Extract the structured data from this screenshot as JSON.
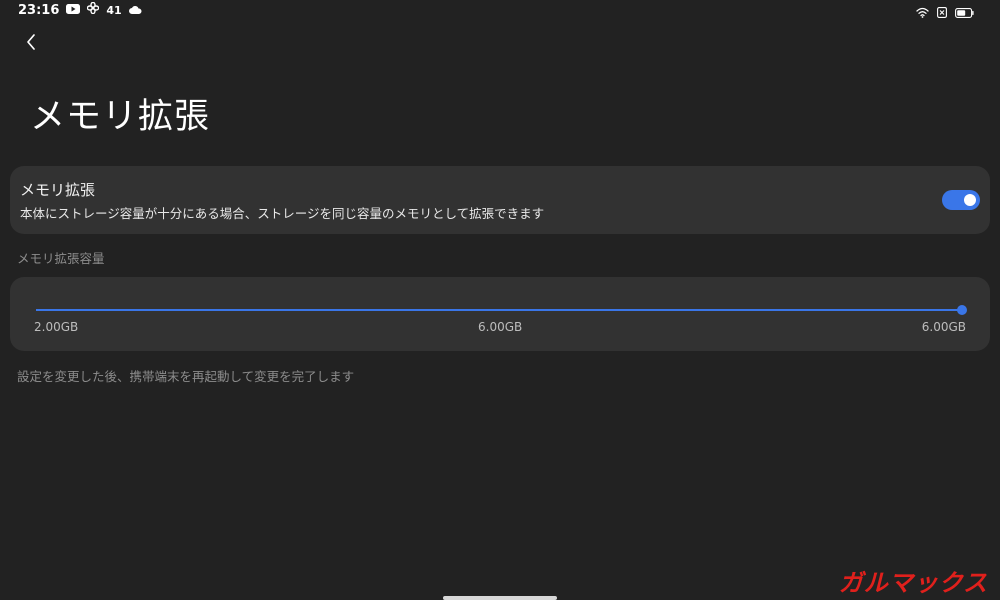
{
  "status_bar": {
    "time": "23:16",
    "notification_count": "41"
  },
  "page": {
    "title": "メモリ拡張"
  },
  "toggle_card": {
    "title": "メモリ拡張",
    "description": "本体にストレージ容量が十分にある場合、ストレージを同じ容量のメモリとして拡張できます",
    "enabled": true
  },
  "slider_section": {
    "label": "メモリ拡張容量",
    "min_label": "2.00GB",
    "mid_label": "6.00GB",
    "max_label": "6.00GB",
    "value_fraction": 1.0
  },
  "note": "設定を変更した後、携帯端末を再起動して変更を完了します",
  "watermark": "ガルマックス",
  "colors": {
    "background": "#222222",
    "card": "#323232",
    "accent": "#3a76e8",
    "watermark": "#e0201c"
  },
  "icons": {
    "status_left": [
      "youtube-icon",
      "fan-icon",
      "cloud-icon"
    ],
    "status_right": [
      "wifi-icon",
      "sim-off-icon",
      "battery-icon"
    ],
    "navigation": "back-arrow-icon"
  }
}
